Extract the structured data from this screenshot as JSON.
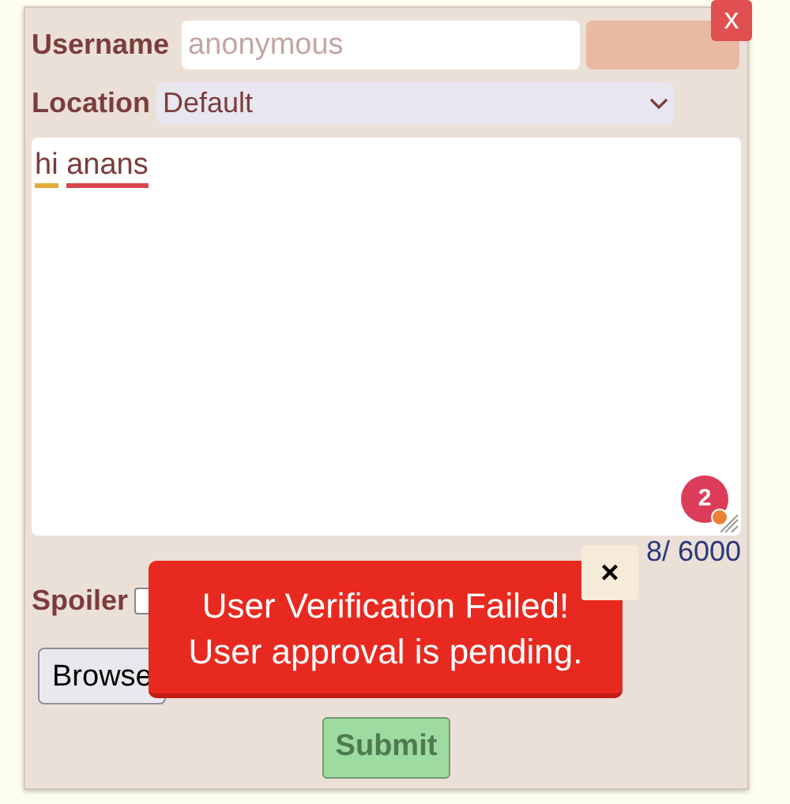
{
  "dialog": {
    "close": "x",
    "username": {
      "label": "Username",
      "placeholder": "anonymous"
    },
    "location": {
      "label": "Location",
      "value": "Default"
    },
    "message": {
      "words": [
        {
          "text": "hi",
          "color": "#e3aa3c"
        },
        {
          "text": "anans",
          "color": "#d9454b"
        }
      ]
    },
    "badge": {
      "count": "2"
    },
    "counter": "8/ 6000",
    "spoiler": {
      "label": "Spoiler",
      "checked": false
    },
    "browse": "Browse",
    "submit": "Submit"
  },
  "toast": {
    "lines": [
      "User Verification Failed!",
      "User approval is pending."
    ],
    "close": "×"
  }
}
